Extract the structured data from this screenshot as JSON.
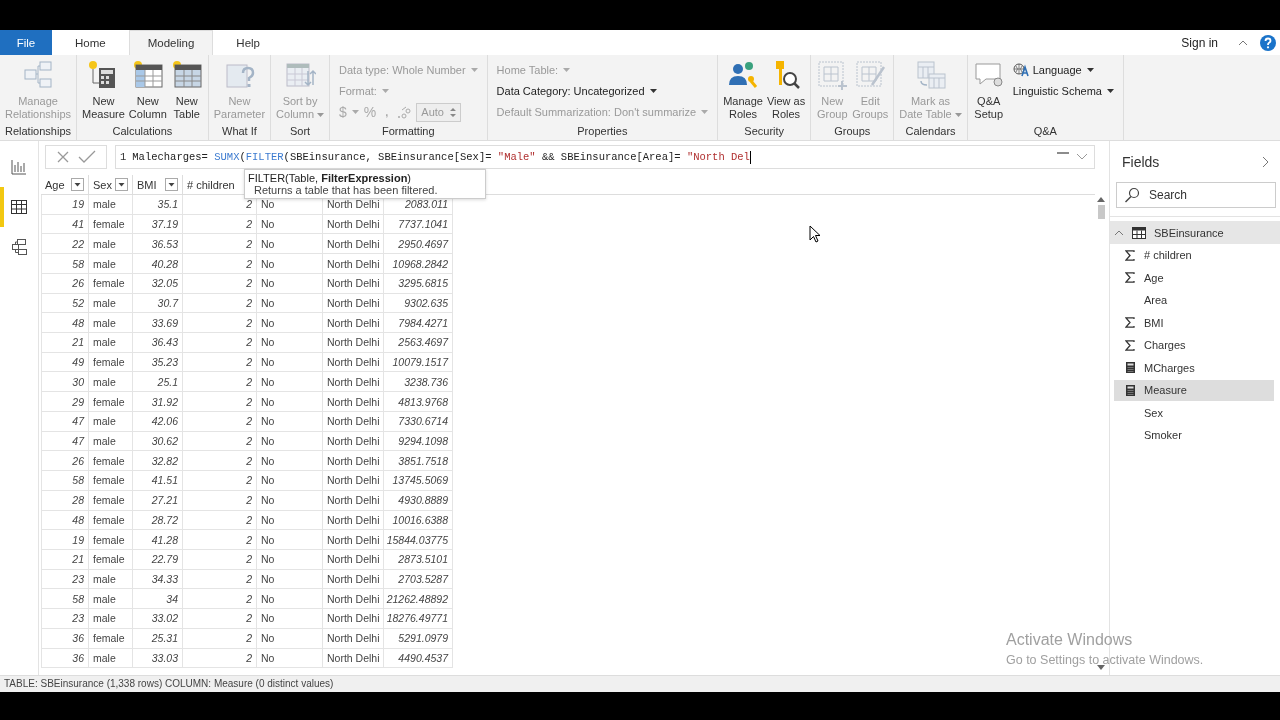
{
  "tabs": [
    {
      "label": "File",
      "kind": "file",
      "selected": false
    },
    {
      "label": "Home",
      "kind": "tab",
      "selected": false
    },
    {
      "label": "Modeling",
      "kind": "tab",
      "selected": true
    },
    {
      "label": "Help",
      "kind": "tab",
      "selected": false
    }
  ],
  "sign_in": "Sign in",
  "ribbon": [
    {
      "label": "Relationships",
      "buttons": [
        {
          "lines": [
            "Manage",
            "Relationships"
          ],
          "disabled": true,
          "dropdown": false
        }
      ]
    },
    {
      "label": "Calculations",
      "buttons": [
        {
          "lines": [
            "New",
            "Measure"
          ],
          "disabled": false,
          "dropdown": false
        },
        {
          "lines": [
            "New",
            "Column"
          ],
          "disabled": false,
          "dropdown": false
        },
        {
          "lines": [
            "New",
            "Table"
          ],
          "disabled": false,
          "dropdown": false
        }
      ]
    },
    {
      "label": "What If",
      "buttons": [
        {
          "lines": [
            "New",
            "Parameter"
          ],
          "disabled": true,
          "dropdown": false
        }
      ]
    },
    {
      "label": "Sort",
      "buttons": [
        {
          "lines": [
            "Sort by",
            "Column"
          ],
          "disabled": true,
          "dropdown": true
        }
      ]
    },
    {
      "label": "Formatting",
      "rows": [
        {
          "kind": "dropdown",
          "label": "Data type: Whole Number",
          "disabled": true
        },
        {
          "kind": "dropdown",
          "label": "Format:",
          "disabled": true
        },
        {
          "kind": "format",
          "currency": "$",
          "percent": "%",
          "comma": ",",
          "decimals": "Auto",
          "disabled": true
        }
      ]
    },
    {
      "label": "Properties",
      "rows": [
        {
          "kind": "dropdown",
          "label": "Home Table:",
          "disabled": true
        },
        {
          "kind": "dropdown",
          "label": "Data Category: Uncategorized",
          "disabled": false
        },
        {
          "kind": "dropdown",
          "label": "Default Summarization: Don't summarize",
          "disabled": true
        }
      ]
    },
    {
      "label": "Security",
      "buttons": [
        {
          "lines": [
            "Manage",
            "Roles"
          ],
          "disabled": false,
          "dropdown": false
        },
        {
          "lines": [
            "View as",
            "Roles"
          ],
          "disabled": false,
          "dropdown": false
        }
      ]
    },
    {
      "label": "Groups",
      "buttons": [
        {
          "lines": [
            "New",
            "Group"
          ],
          "disabled": true,
          "dropdown": false
        },
        {
          "lines": [
            "Edit",
            "Groups"
          ],
          "disabled": true,
          "dropdown": false
        }
      ]
    },
    {
      "label": "Calendars",
      "buttons": [
        {
          "lines": [
            "Mark as",
            "Date Table"
          ],
          "disabled": true,
          "dropdown": true
        }
      ]
    },
    {
      "label": "Q&A",
      "buttons": [
        {
          "lines": [
            "Q&A",
            "Setup"
          ],
          "disabled": false,
          "dropdown": false
        }
      ],
      "rows": [
        {
          "kind": "icon_dropdown",
          "label": "Language",
          "disabled": false
        },
        {
          "kind": "dropdown",
          "label": "Linguistic Schema",
          "disabled": false
        }
      ]
    }
  ],
  "views": [
    {
      "selected": false
    },
    {
      "selected": true
    },
    {
      "selected": false
    }
  ],
  "formula": {
    "line_number": "1",
    "tokens": [
      {
        "text": "Malecharges= ",
        "kind": "plain"
      },
      {
        "text": "SUMX",
        "kind": "function"
      },
      {
        "text": "(",
        "kind": "plain"
      },
      {
        "text": "FILTER",
        "kind": "function"
      },
      {
        "text": "(SBEinsurance, SBEinsurance[Sex]= ",
        "kind": "plain"
      },
      {
        "text": "\"Male\"",
        "kind": "string"
      },
      {
        "text": " && SBEinsurance[Area]= ",
        "kind": "plain"
      },
      {
        "text": "\"North Del",
        "kind": "string"
      }
    ]
  },
  "tooltip": {
    "signature": "FILTER(Table, **FilterExpression**)",
    "description": "Returns a table that has been filtered."
  },
  "table": {
    "columns": [
      "Age",
      "Sex",
      "BMI",
      "# children"
    ],
    "rows": [
      {
        "cells": [
          "19",
          "male",
          "35.1",
          "2",
          "No",
          "North Delhi",
          "2083.011"
        ]
      },
      {
        "cells": [
          "41",
          "female",
          "37.19",
          "2",
          "No",
          "North Delhi",
          "7737.1041"
        ]
      },
      {
        "cells": [
          "22",
          "male",
          "36.53",
          "2",
          "No",
          "North Delhi",
          "2950.4697"
        ]
      },
      {
        "cells": [
          "58",
          "male",
          "40.28",
          "2",
          "No",
          "North Delhi",
          "10968.2842"
        ]
      },
      {
        "cells": [
          "26",
          "female",
          "32.05",
          "2",
          "No",
          "North Delhi",
          "3295.6815"
        ]
      },
      {
        "cells": [
          "52",
          "male",
          "30.7",
          "2",
          "No",
          "North Delhi",
          "9302.635"
        ]
      },
      {
        "cells": [
          "48",
          "male",
          "33.69",
          "2",
          "No",
          "North Delhi",
          "7984.4271"
        ]
      },
      {
        "cells": [
          "21",
          "male",
          "36.43",
          "2",
          "No",
          "North Delhi",
          "2563.4697"
        ]
      },
      {
        "cells": [
          "49",
          "female",
          "35.23",
          "2",
          "No",
          "North Delhi",
          "10079.1517"
        ]
      },
      {
        "cells": [
          "30",
          "male",
          "25.1",
          "2",
          "No",
          "North Delhi",
          "3238.736"
        ]
      },
      {
        "cells": [
          "29",
          "female",
          "31.92",
          "2",
          "No",
          "North Delhi",
          "4813.9768"
        ]
      },
      {
        "cells": [
          "47",
          "male",
          "42.06",
          "2",
          "No",
          "North Delhi",
          "7330.6714"
        ]
      },
      {
        "cells": [
          "47",
          "male",
          "30.62",
          "2",
          "No",
          "North Delhi",
          "9294.1098"
        ]
      },
      {
        "cells": [
          "26",
          "female",
          "32.82",
          "2",
          "No",
          "North Delhi",
          "3851.7518"
        ]
      },
      {
        "cells": [
          "58",
          "female",
          "41.51",
          "2",
          "No",
          "North Delhi",
          "13745.5069"
        ]
      },
      {
        "cells": [
          "28",
          "female",
          "27.21",
          "2",
          "No",
          "North Delhi",
          "4930.8889"
        ]
      },
      {
        "cells": [
          "48",
          "female",
          "28.72",
          "2",
          "No",
          "North Delhi",
          "10016.6388"
        ]
      },
      {
        "cells": [
          "19",
          "female",
          "41.28",
          "2",
          "No",
          "North Delhi",
          "15844.03775"
        ]
      },
      {
        "cells": [
          "21",
          "female",
          "22.79",
          "2",
          "No",
          "North Delhi",
          "2873.5101"
        ]
      },
      {
        "cells": [
          "23",
          "male",
          "34.33",
          "2",
          "No",
          "North Delhi",
          "2703.5287"
        ]
      },
      {
        "cells": [
          "58",
          "male",
          "34",
          "2",
          "No",
          "North Delhi",
          "21262.48892"
        ]
      },
      {
        "cells": [
          "23",
          "male",
          "33.02",
          "2",
          "No",
          "North Delhi",
          "18276.49771"
        ]
      },
      {
        "cells": [
          "36",
          "female",
          "25.31",
          "2",
          "No",
          "North Delhi",
          "5291.0979"
        ]
      },
      {
        "cells": [
          "36",
          "male",
          "33.03",
          "2",
          "No",
          "North Delhi",
          "4490.4537"
        ]
      }
    ]
  },
  "fields": {
    "title": "Fields",
    "search": {
      "placeholder": "Search"
    },
    "table": {
      "name": "SBEinsurance",
      "expanded": true,
      "children": [
        {
          "name": "# children",
          "kind": "sum",
          "selected": false
        },
        {
          "name": "Age",
          "kind": "sum",
          "selected": false
        },
        {
          "name": "Area",
          "kind": "text",
          "selected": false
        },
        {
          "name": "BMI",
          "kind": "sum",
          "selected": false
        },
        {
          "name": "Charges",
          "kind": "sum",
          "selected": false
        },
        {
          "name": "MCharges",
          "kind": "measure",
          "selected": false
        },
        {
          "name": "Measure",
          "kind": "measure",
          "selected": true
        },
        {
          "name": "Sex",
          "kind": "text",
          "selected": false
        },
        {
          "name": "Smoker",
          "kind": "text",
          "selected": false
        }
      ]
    }
  },
  "status_bar": "TABLE: SBEinsurance (1,338 rows) COLUMN: Measure (0 distinct values)",
  "activation_notice": {
    "title": "Activate Windows",
    "subtitle": "Go to Settings to activate Windows."
  }
}
